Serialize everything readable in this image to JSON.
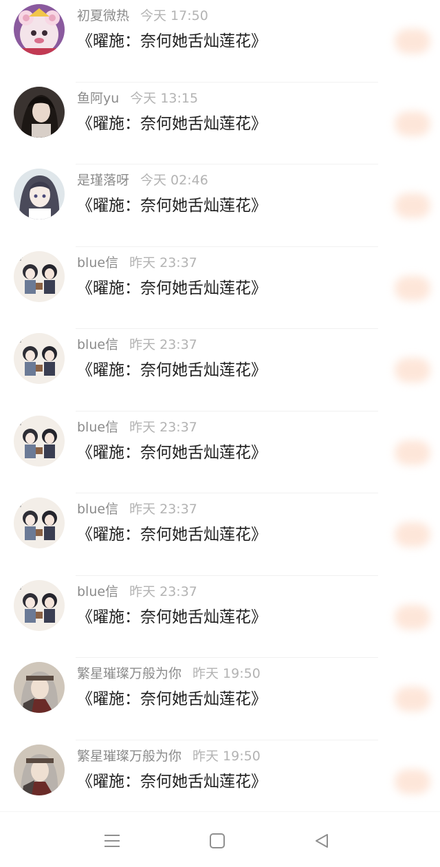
{
  "colors": {
    "username": "#8b8b8b",
    "timestamp": "#b3b3b3",
    "message": "#1f1f1f",
    "reward_badge": "#fde2d3",
    "nav_icon": "#8f8f8f"
  },
  "messages": [
    {
      "username": "初夏微热",
      "time": "今天 17:50",
      "text": "《曜施：奈何她舌灿莲花》",
      "avatar": "bear-avatar"
    },
    {
      "username": "鱼阿yu",
      "time": "今天 13:15",
      "text": "《曜施：奈何她舌灿莲花》",
      "avatar": "dark-hair-girl-avatar"
    },
    {
      "username": "是瑾落呀",
      "time": "今天 02:46",
      "text": "《曜施：奈何她舌灿莲花》",
      "avatar": "anime-girl-avatar"
    },
    {
      "username": "blue信",
      "time": "昨天 23:37",
      "text": "《曜施：奈何她舌灿莲花》",
      "avatar": "chibi-couple-avatar"
    },
    {
      "username": "blue信",
      "time": "昨天 23:37",
      "text": "《曜施：奈何她舌灿莲花》",
      "avatar": "chibi-couple-avatar"
    },
    {
      "username": "blue信",
      "time": "昨天 23:37",
      "text": "《曜施：奈何她舌灿莲花》",
      "avatar": "chibi-couple-avatar"
    },
    {
      "username": "blue信",
      "time": "昨天 23:37",
      "text": "《曜施：奈何她舌灿莲花》",
      "avatar": "chibi-couple-avatar"
    },
    {
      "username": "blue信",
      "time": "昨天 23:37",
      "text": "《曜施：奈何她舌灿莲花》",
      "avatar": "chibi-couple-avatar"
    },
    {
      "username": "繁星璀璨万般为你",
      "time": "昨天 19:50",
      "text": "《曜施：奈何她舌灿莲花》",
      "avatar": "warrior-avatar"
    },
    {
      "username": "繁星璀璨万般为你",
      "time": "昨天 19:50",
      "text": "《曜施：奈何她舌灿莲花》",
      "avatar": "warrior-avatar"
    }
  ],
  "navbar": {
    "menu_icon": "menu-icon",
    "home_icon": "home-icon",
    "back_icon": "back-icon"
  }
}
